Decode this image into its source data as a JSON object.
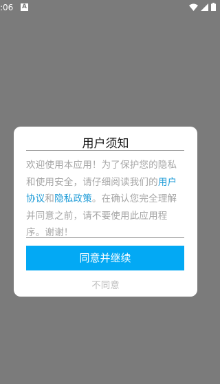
{
  "status_bar": {
    "time": ":06",
    "app_icon_letter": "A",
    "icons": [
      "wifi-icon",
      "signal-icon",
      "battery-icon"
    ]
  },
  "dialog": {
    "title": "用户须知",
    "body": {
      "text_1": "欢迎使用本应用！为了保护您的隐私和使用安全，请仔细阅读我们的",
      "link_user_agreement": "用户协议",
      "text_2": "和",
      "link_privacy_policy": "隐私政策",
      "text_3": "。在确认您完全理解并同意之前，请不要使用此应用程序。谢谢！"
    },
    "agree_button": "同意并继续",
    "disagree_button": "不同意"
  },
  "colors": {
    "background": "#7b7b7b",
    "accent": "#03a9f4",
    "link": "#1d9bd7"
  }
}
